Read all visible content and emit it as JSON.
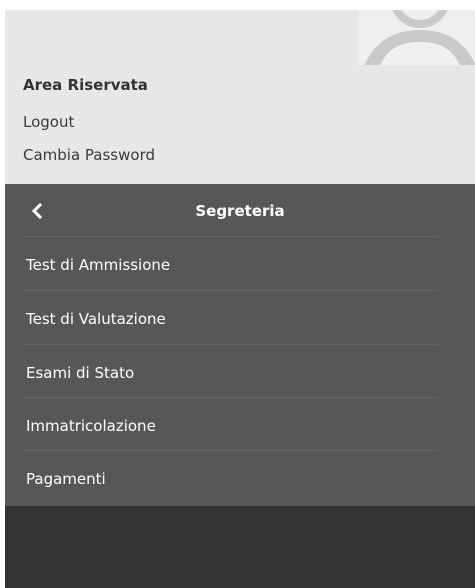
{
  "user_area": {
    "title": "Area Riservata",
    "logout_label": "Logout",
    "change_password_label": "Cambia Password",
    "avatar_icon": "user-silhouette-icon"
  },
  "menu": {
    "back_icon": "chevron-left-icon",
    "title": "Segreteria",
    "items": [
      {
        "label": "Test di Ammissione"
      },
      {
        "label": "Test di Valutazione"
      },
      {
        "label": "Esami di Stato"
      },
      {
        "label": "Immatricolazione"
      },
      {
        "label": "Pagamenti"
      }
    ]
  },
  "colors": {
    "user_area_bg": "#e7e7e7",
    "menu_bg": "#575757",
    "footer_bg": "#333333",
    "menu_text": "#ffffff"
  }
}
